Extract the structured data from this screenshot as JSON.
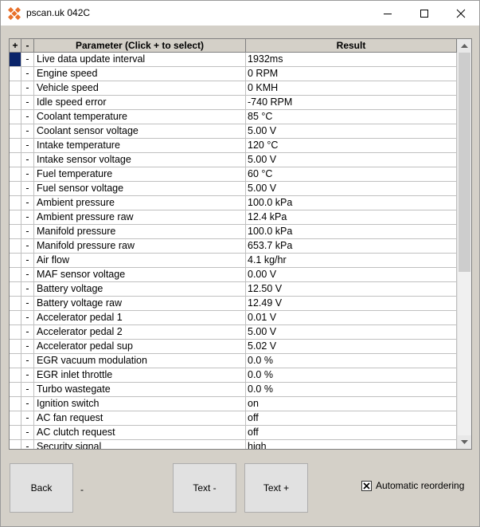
{
  "window": {
    "title": "pscan.uk 042C"
  },
  "grid": {
    "columns": {
      "plus": "+",
      "minus": "-",
      "parameter": "Parameter (Click + to select)",
      "result": "Result"
    },
    "rows": [
      {
        "mark": "-",
        "param": "Live data update interval",
        "result": "1932ms"
      },
      {
        "mark": "-",
        "param": "Engine speed",
        "result": "0 RPM"
      },
      {
        "mark": "-",
        "param": "Vehicle speed",
        "result": "0 KMH"
      },
      {
        "mark": "-",
        "param": "Idle speed error",
        "result": "-740 RPM"
      },
      {
        "mark": "-",
        "param": "Coolant temperature",
        "result": "85 °C"
      },
      {
        "mark": "-",
        "param": "Coolant sensor voltage",
        "result": "5.00 V"
      },
      {
        "mark": "-",
        "param": "Intake temperature",
        "result": "120 °C"
      },
      {
        "mark": "-",
        "param": "Intake sensor voltage",
        "result": "5.00 V"
      },
      {
        "mark": "-",
        "param": "Fuel temperature",
        "result": "60 °C"
      },
      {
        "mark": "-",
        "param": "Fuel sensor voltage",
        "result": "5.00 V"
      },
      {
        "mark": "-",
        "param": "Ambient pressure",
        "result": "100.0 kPa"
      },
      {
        "mark": "-",
        "param": "Ambient pressure raw",
        "result": "12.4 kPa"
      },
      {
        "mark": "-",
        "param": "Manifold pressure",
        "result": "100.0 kPa"
      },
      {
        "mark": "-",
        "param": "Manifold pressure raw",
        "result": "653.7 kPa"
      },
      {
        "mark": "-",
        "param": "Air flow",
        "result": "4.1 kg/hr"
      },
      {
        "mark": "-",
        "param": "MAF sensor voltage",
        "result": "0.00 V"
      },
      {
        "mark": "-",
        "param": "Battery voltage",
        "result": "12.50 V"
      },
      {
        "mark": "-",
        "param": "Battery voltage raw",
        "result": "12.49 V"
      },
      {
        "mark": "-",
        "param": "Accelerator pedal 1",
        "result": "0.01 V"
      },
      {
        "mark": "-",
        "param": "Accelerator pedal 2",
        "result": "5.00 V"
      },
      {
        "mark": "-",
        "param": "Accelerator pedal sup",
        "result": "5.02 V"
      },
      {
        "mark": "-",
        "param": "EGR vacuum modulation",
        "result": "0.0 %"
      },
      {
        "mark": "-",
        "param": "EGR inlet throttle",
        "result": "0.0 %"
      },
      {
        "mark": "-",
        "param": "Turbo wastegate",
        "result": "0.0 %"
      },
      {
        "mark": "-",
        "param": "Ignition switch",
        "result": "on"
      },
      {
        "mark": "-",
        "param": "AC fan request",
        "result": "off"
      },
      {
        "mark": "-",
        "param": "AC clutch request",
        "result": "off"
      },
      {
        "mark": "-",
        "param": "Security signal",
        "result": "high"
      }
    ]
  },
  "buttons": {
    "back": "Back",
    "text_minus": "Text -",
    "text_plus": "Text +"
  },
  "status_dash": "-",
  "auto_reorder": {
    "label": "Automatic reordering",
    "checked": true
  },
  "colors": {
    "selection": "#0a246a",
    "face": "#d4d0c8"
  }
}
